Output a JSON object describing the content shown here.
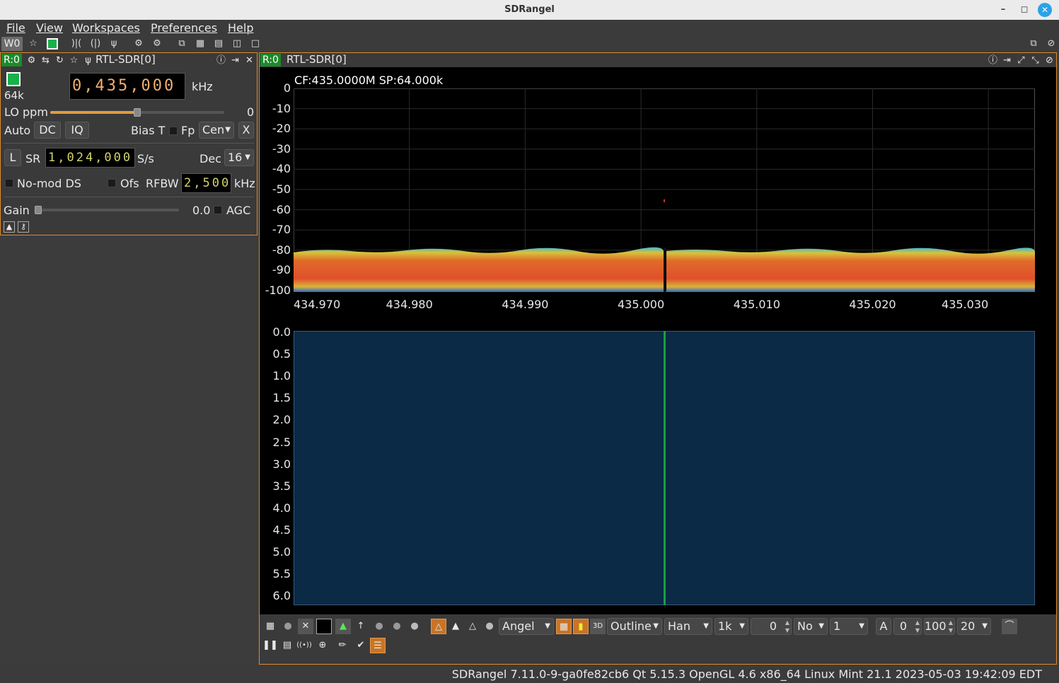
{
  "window": {
    "title": "SDRangel"
  },
  "menu": {
    "file": "File",
    "view": "View",
    "workspaces": "Workspaces",
    "preferences": "Preferences",
    "help": "Help"
  },
  "toolbar": {
    "workspace": "W0"
  },
  "device_panel": {
    "badge": "R:0",
    "title": "RTL-SDR[0]",
    "sample_rate_short": "64k",
    "center_freq": "0,435,000",
    "freq_unit": "kHz",
    "lo_ppm_label": "LO ppm",
    "lo_ppm_value": "0",
    "lo_ppm_fraction": 0.5,
    "auto_label": "Auto",
    "dc_label": "DC",
    "iq_label": "IQ",
    "bias_t_label": "Bias T",
    "fp_label": "Fp",
    "fc_pos": "Cen",
    "x_label": "X",
    "l_label": "L",
    "sr_label": "SR",
    "sample_rate": "1,024,000",
    "sr_unit": "S/s",
    "dec_label": "Dec",
    "dec_value": "16",
    "nomod_label": "No-mod DS",
    "ofs_label": "Ofs",
    "rfbw_label": "RFBW",
    "rfbw_value": "2,500",
    "rfbw_unit": "kHz",
    "gain_label": "Gain",
    "gain_value": "0.0",
    "agc_label": "AGC",
    "gain_fraction": 0.0
  },
  "spectrum_panel": {
    "badge": "R:0",
    "title": "RTL-SDR[0]",
    "info": "CF:435.0000M SP:64.000k",
    "y_ticks": [
      "0",
      "-10",
      "-20",
      "-30",
      "-40",
      "-50",
      "-60",
      "-70",
      "-80",
      "-90",
      "-100"
    ],
    "x_ticks": [
      "434.970",
      "434.980",
      "434.990",
      "435.000",
      "435.010",
      "435.020",
      "435.030"
    ],
    "wf_ticks": [
      "0.0",
      "0.5",
      "1.0",
      "1.5",
      "2.0",
      "2.5",
      "3.0",
      "3.5",
      "4.0",
      "4.5",
      "5.0",
      "5.5",
      "6.0"
    ]
  },
  "controls": {
    "palette": "Angel",
    "outline": "Outline",
    "window": "Han",
    "fft_size": "1k",
    "fft_overlap": "0",
    "avg_mode": "No",
    "avg_value": "1",
    "a_label": "A",
    "ref_level": "0",
    "range": "100",
    "fps": "20"
  },
  "status": {
    "text": "SDRangel 7.11.0-9-ga0fe82cb6 Qt 5.15.3 OpenGL 4.6 x86_64 Linux Mint 21.1 2023-05-03 19:42:09 EDT"
  },
  "colors": {
    "accent": "#e08a2c",
    "badge": "#1d8a2a",
    "waterfall": "#0b2a45",
    "line": "#18a040"
  }
}
